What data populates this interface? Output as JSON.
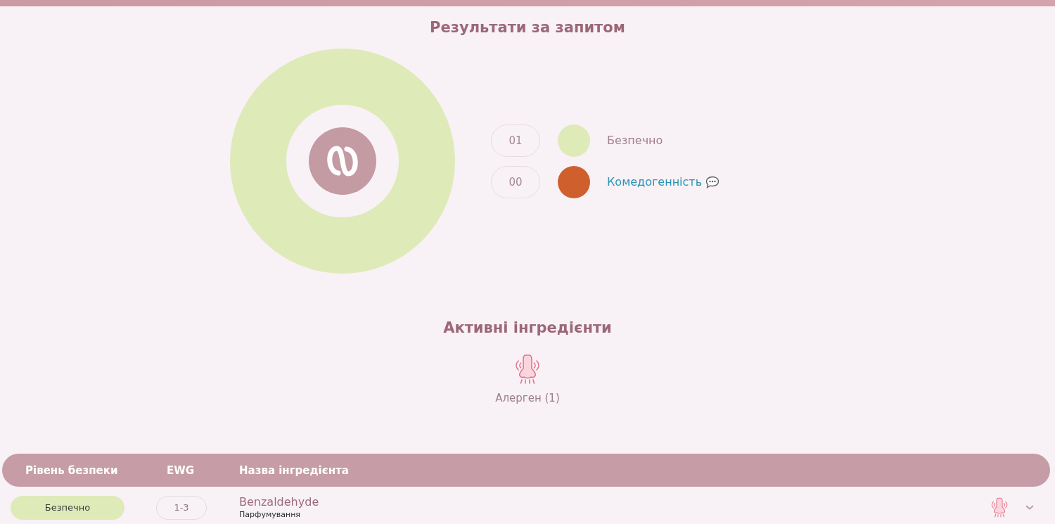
{
  "title": "Результати за запитом",
  "legend": [
    {
      "count": "01",
      "label": "Безпечно",
      "color": "#dfeab9",
      "kind": "plain",
      "note": false
    },
    {
      "count": "00",
      "label": "Комедогенність",
      "color": "#cf602e",
      "kind": "link",
      "note": true
    }
  ],
  "active_ingredients": {
    "title": "Активні інгредієнти",
    "items": [
      {
        "kind": "allergen",
        "label": "Алерген (1)"
      }
    ]
  },
  "table": {
    "columns": [
      "Рівень безпеки",
      "EWG",
      "Назва інгредієнта"
    ],
    "rows": [
      {
        "safety": {
          "label": "Безпечно",
          "kind": "safe"
        },
        "ewg": "1-3",
        "name": "Benzaldehyde",
        "function": "Парфумування",
        "flags": [
          {
            "kind": "allergen"
          }
        ],
        "expanded": false
      }
    ]
  }
}
